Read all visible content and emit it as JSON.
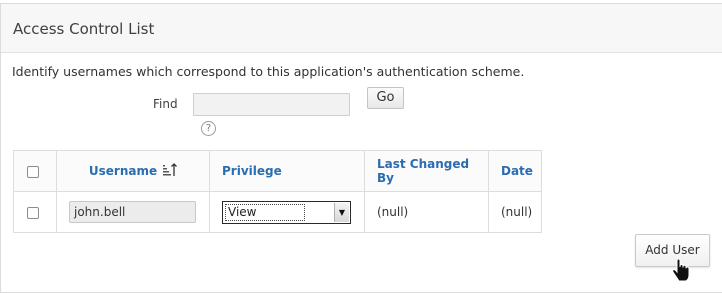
{
  "panel": {
    "title": "Access Control List",
    "description": "Identify usernames which correspond to this application's authentication scheme."
  },
  "search": {
    "label": "Find",
    "value": "",
    "placeholder": "",
    "go_label": "Go",
    "help_icon": "help-circle-icon",
    "help_glyph": "?"
  },
  "table": {
    "headers": {
      "username": "Username",
      "privilege": "Privilege",
      "last_changed_by": "Last Changed By",
      "date": "Date"
    },
    "sort_icon": "sort-ascending-icon",
    "rows": [
      {
        "checked": false,
        "username": "john.bell",
        "privilege": "View",
        "last_changed_by": "(null)",
        "date": "(null)"
      }
    ]
  },
  "actions": {
    "add_user_label": "Add User"
  },
  "cursor": "hand-pointer-icon",
  "colors": {
    "link_header": "#2a6db0",
    "header_bg": "#f7f7f7",
    "border": "#dddddd"
  }
}
